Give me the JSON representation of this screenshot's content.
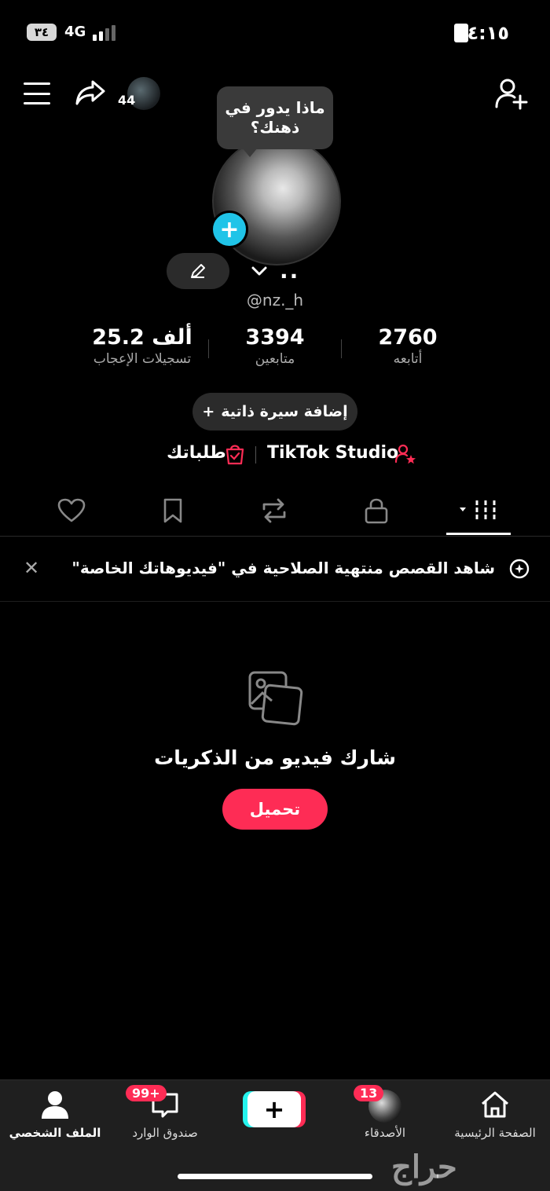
{
  "status_bar": {
    "time": "٤:١٥",
    "battery": "٣٤",
    "network": "4G"
  },
  "header": {
    "share_count": "44"
  },
  "profile": {
    "bubble_text": "ماذا يدور في ذهنك؟",
    "display_name": "..",
    "username": "@nz._h"
  },
  "stats": [
    {
      "value": "2760",
      "label": "أتابعه"
    },
    {
      "value": "3394",
      "label": "متابعين"
    },
    {
      "value": "25.2 ألف",
      "label": "تسجيلات الإعجاب"
    }
  ],
  "bio_button": "إضافة سيرة ذاتية",
  "links": {
    "studio": "TikTok Studio",
    "orders": "طلباتك"
  },
  "notice": {
    "text": "شاهد القصص منتهية الصلاحية في \"فيديوهاتك الخاصة\""
  },
  "empty_state": {
    "title": "شارك فيديو من الذكريات",
    "button": "تحميل"
  },
  "bottom_nav": {
    "home": "الصفحة الرئيسية",
    "friends": "الأصدقاء",
    "friends_badge": "13",
    "inbox": "صندوق الوارد",
    "inbox_badge": "99+",
    "profile": "الملف الشخصي"
  },
  "watermark": "حراج",
  "colors": {
    "accent": "#fe2c55",
    "cyan": "#25f4ee",
    "plus_badge": "#20c4e8"
  }
}
